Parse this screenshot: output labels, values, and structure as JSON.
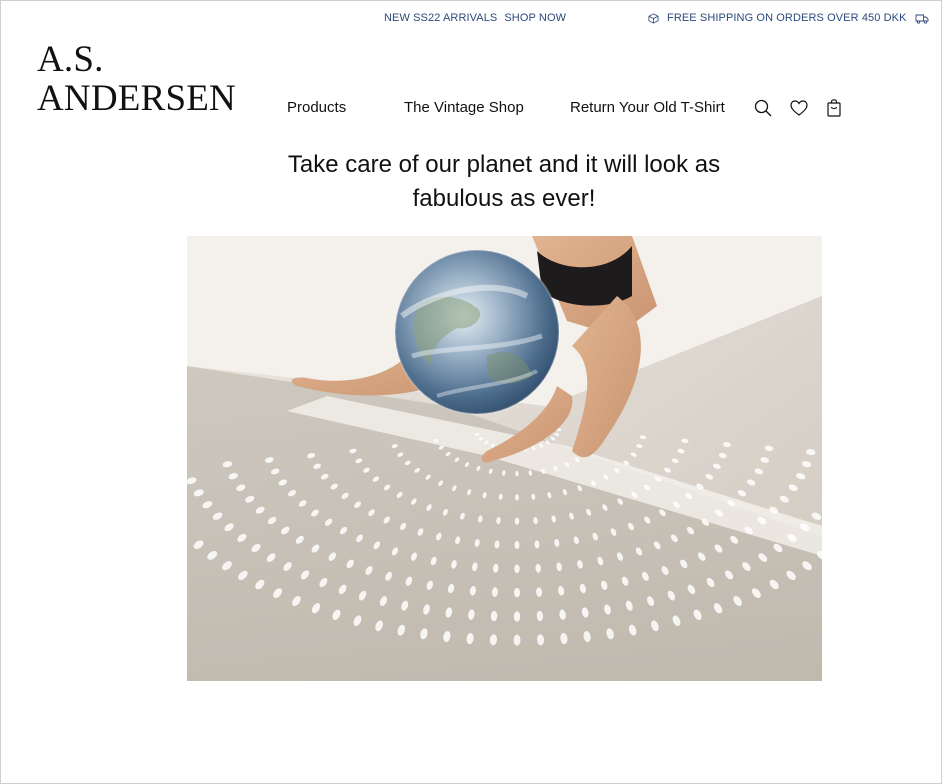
{
  "topbar": {
    "promo_new": "NEW SS22 ARRIVALS",
    "promo_shop": "SHOP NOW",
    "shipping_text": "FREE SHIPPING ON ORDERS OVER 450 DKK",
    "color": "#2c4a7a"
  },
  "brand": {
    "line1": "A.S.",
    "line2": "ANDERSEN"
  },
  "nav": {
    "items": [
      {
        "label": "Products"
      },
      {
        "label": "The Vintage Shop"
      },
      {
        "label": "Return Your Old T-Shirt"
      }
    ],
    "icons": [
      "search-icon",
      "heart-icon",
      "shopping-bag-icon"
    ]
  },
  "hero": {
    "headline": "Take care of our planet and it will look as fabulous as ever!",
    "image_subject": "person-with-globe-photo"
  }
}
